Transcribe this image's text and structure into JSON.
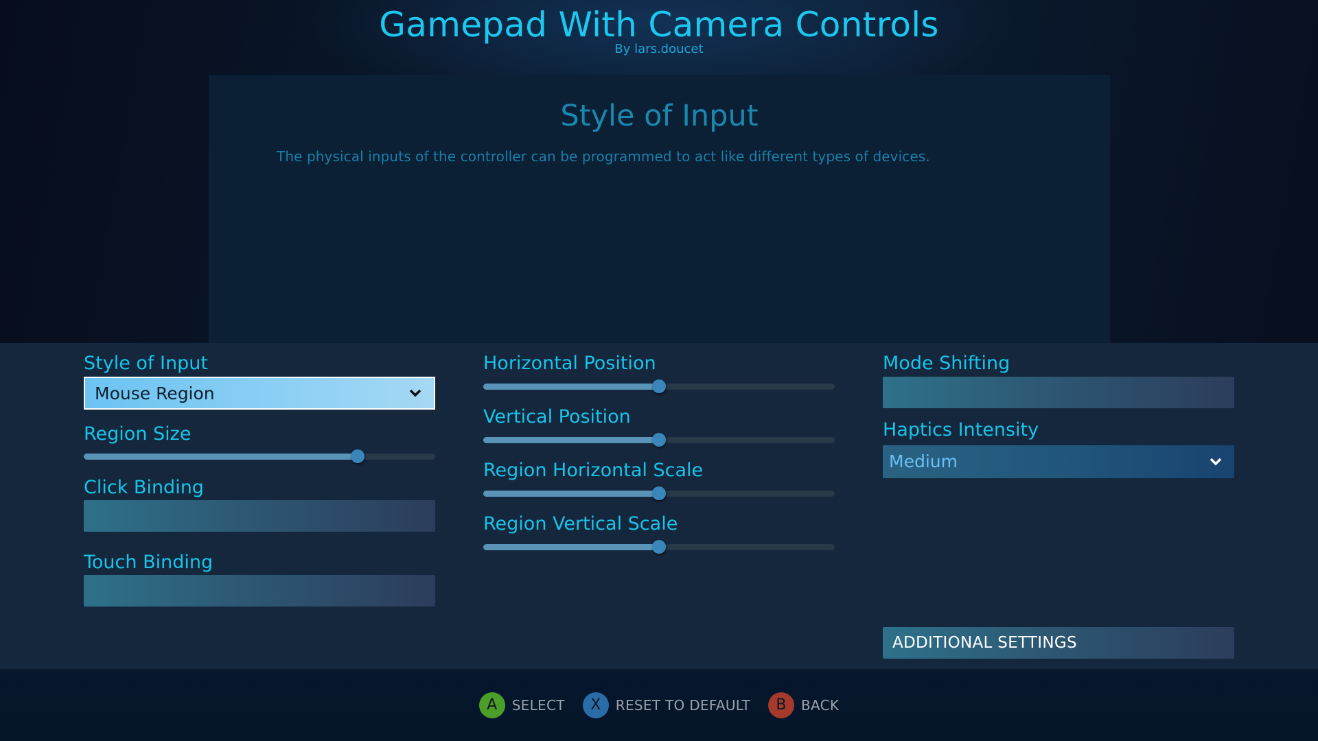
{
  "header": {
    "title": "Gamepad With Camera Controls",
    "author": "By lars.doucet"
  },
  "info": {
    "title": "Style of Input",
    "description": "The physical inputs of the controller can be programmed to act like different types of devices."
  },
  "left_column": {
    "style_of_input": {
      "label": "Style of Input",
      "value": "Mouse Region"
    },
    "region_size": {
      "label": "Region Size",
      "value_percent": 78
    },
    "click_binding": {
      "label": "Click Binding",
      "value": ""
    },
    "touch_binding": {
      "label": "Touch Binding",
      "value": ""
    }
  },
  "middle_column": {
    "sliders": [
      {
        "label": "Horizontal Position",
        "value_percent": 50
      },
      {
        "label": "Vertical Position",
        "value_percent": 50
      },
      {
        "label": "Region Horizontal Scale",
        "value_percent": 50
      },
      {
        "label": "Region Vertical Scale",
        "value_percent": 50
      }
    ]
  },
  "right_column": {
    "mode_shifting": {
      "label": "Mode Shifting",
      "value": ""
    },
    "haptics_intensity": {
      "label": "Haptics Intensity",
      "value": "Medium"
    },
    "additional_settings": {
      "label": "ADDITIONAL SETTINGS"
    }
  },
  "footer": {
    "hints": [
      {
        "button": "A",
        "label": "SELECT",
        "color": "#4b9e28"
      },
      {
        "button": "X",
        "label": "RESET TO DEFAULT",
        "color": "#2a6ca8"
      },
      {
        "button": "B",
        "label": "BACK",
        "color": "#a53a2c"
      }
    ]
  },
  "colors": {
    "accent": "#1ac3e8",
    "panel": "#14273d",
    "slider_fill": "#5a93b8",
    "slider_thumb": "#3a86bb"
  }
}
